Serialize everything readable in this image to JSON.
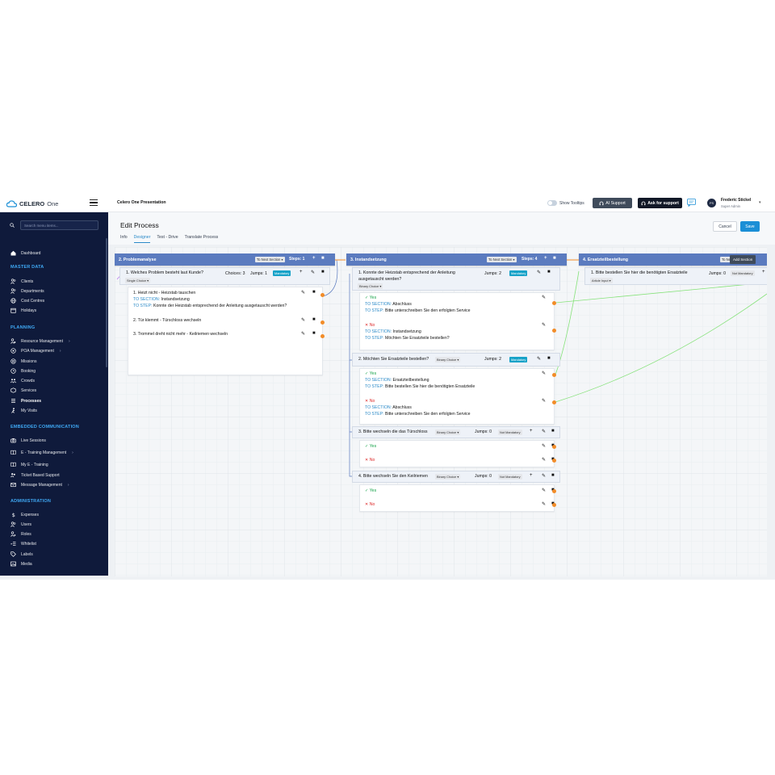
{
  "header": {
    "brand": "CELERO",
    "brand_suffix": "One",
    "project": "Celero One Presentation",
    "tooltips_label": "Show Tooltips",
    "ai_support": "AI Support",
    "ask_support": "Ask for support",
    "user_initials": "FS",
    "user_name": "Frederic Stickel",
    "user_role": "Super Admin"
  },
  "sidebar": {
    "search_placeholder": "Search menu items...",
    "dashboard": "Dashboard",
    "sections": [
      {
        "title": "MASTER DATA",
        "items": [
          "Clients",
          "Departments",
          "Cost Centres",
          "Holidays"
        ]
      },
      {
        "title": "PLANNING",
        "items": [
          "Resource Management",
          "POA Management",
          "Missions",
          "Booking",
          "Crowds",
          "Services",
          "Processes",
          "My Visits"
        ]
      },
      {
        "title": "EMBEDDED COMMUNICATION",
        "items": [
          "Live Sessions",
          "E - Training Management",
          "My E - Training",
          "Ticket Based Support",
          "Message Management"
        ]
      },
      {
        "title": "ADMINISTRATION",
        "items": [
          "Expenses",
          "Users",
          "Roles",
          "Whitelist",
          "Labels",
          "Media"
        ]
      }
    ]
  },
  "page": {
    "title": "Edit Process",
    "tabs": [
      "Info",
      "Designer",
      "Test - Drive",
      "Translate Process"
    ],
    "active_tab": "Designer",
    "cancel": "Cancel",
    "save": "Save",
    "add_section": "Add Section"
  },
  "designer": {
    "sections": [
      {
        "title": "2. Problemanalyse",
        "flow": "To Next Section",
        "steps": "Steps: 1",
        "questions": [
          {
            "text": "1. Welches Problem besteht laut Kunde?",
            "type": "Single Choice",
            "choices": "Choices: 3",
            "jumps": "Jumps: 1",
            "required": "Mandatory",
            "answers": [
              {
                "text": "1. Heizt nicht - Heizstab tauschen",
                "to_section_label": "TO SECTION:",
                "to_section": "Instandsetzung",
                "to_step_label": "TO STEP:",
                "to_step": "Konnte der Heizstab entsprechend der Anleitung ausgetauscht werden?"
              },
              {
                "text": "2. Tür klemmt - Türschloss wechseln"
              },
              {
                "text": "3. Trommel dreht nicht mehr - Keilriemen wechseln"
              }
            ]
          }
        ]
      },
      {
        "title": "3. Instandsetzung",
        "flow": "To Next Section",
        "steps": "Steps: 4",
        "questions": [
          {
            "text": "1. Konnte der Heizstab entsprechend der Anleitung ausgetauscht werden?",
            "type": "Binary Choice",
            "jumps": "Jumps: 2",
            "required": "Mandatory",
            "answers": [
              {
                "text": "Yes",
                "to_section_label": "TO SECTION:",
                "to_section": "Abschluss",
                "to_step_label": "TO STEP:",
                "to_step": "Bitte unterschreiben Sie den erfolgten Service"
              },
              {
                "text": "No",
                "to_section_label": "TO SECTION:",
                "to_section": "Instandsetzung",
                "to_step_label": "TO STEP:",
                "to_step": "Möchten Sie Ersatzteile bestellen?"
              }
            ]
          },
          {
            "text": "2. Möchten Sie Ersatzteile bestellen?",
            "type": "Binary Choice",
            "jumps": "Jumps: 2",
            "required": "Mandatory",
            "answers": [
              {
                "text": "Yes",
                "to_section_label": "TO SECTION:",
                "to_section": "Ersatzteilbestellung",
                "to_step_label": "TO STEP:",
                "to_step": "Bitte bestellen Sie hier die benötigten Ersatzteile"
              },
              {
                "text": "No",
                "to_section_label": "TO SECTION:",
                "to_section": "Abschluss",
                "to_step_label": "TO STEP:",
                "to_step": "Bitte unterschreiben Sie den erfolgten Service"
              }
            ]
          },
          {
            "text": "3. Bitte wechseln die das Türschloss",
            "type": "Binary Choice",
            "jumps": "Jumps: 0",
            "required": "Not Mandatory",
            "answers": [
              {
                "text": "Yes"
              },
              {
                "text": "No"
              }
            ]
          },
          {
            "text": "4. Bitte wechseln Sie den Keilriemen",
            "type": "Binary Choice",
            "jumps": "Jumps: 0",
            "required": "Not Mandatory",
            "answers": [
              {
                "text": "Yes"
              },
              {
                "text": "No"
              }
            ]
          }
        ]
      },
      {
        "title": "4. Ersatzteilbestellung",
        "flow": "To Next Section",
        "questions": [
          {
            "text": "1. Bitte bestellen Sie hier die benötigten Ersatzteile",
            "type": "Article Input",
            "jumps": "Jumps: 0",
            "required": "Not Mandatory"
          }
        ]
      }
    ]
  }
}
